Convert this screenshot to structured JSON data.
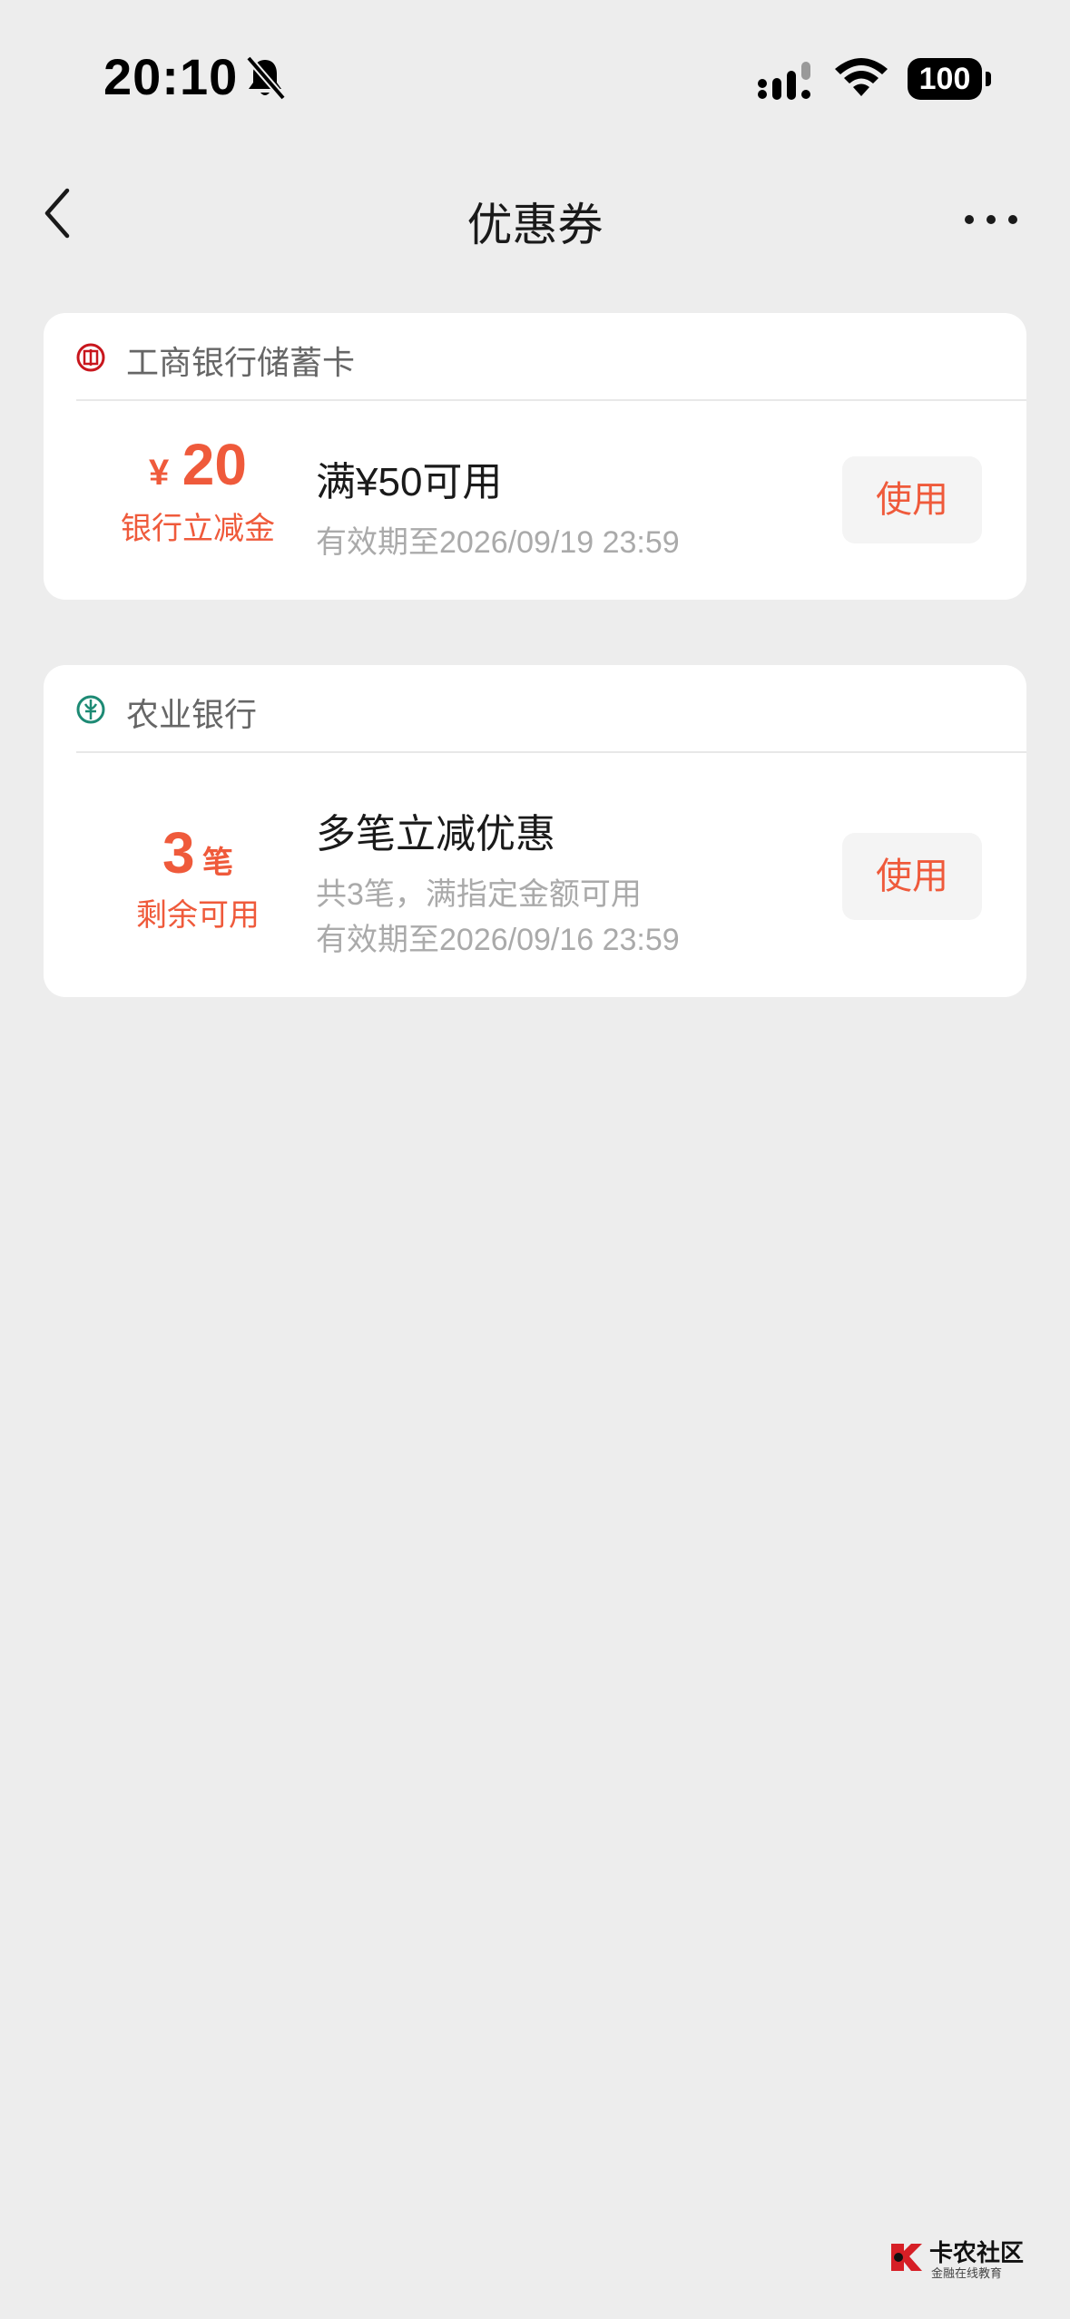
{
  "status_bar": {
    "time": "20:10",
    "battery": "100"
  },
  "nav": {
    "title": "优惠券"
  },
  "coupons": [
    {
      "bank": "工商银行储蓄卡",
      "amount_prefix": "¥",
      "amount": "20",
      "amount_label": "银行立减金",
      "title": "满¥50可用",
      "validity": "有效期至2026/09/19 23:59",
      "button": "使用",
      "logo_color": "#c8161d"
    },
    {
      "bank": "农业银行",
      "count": "3",
      "count_unit": "笔",
      "count_label": "剩余可用",
      "title": "多笔立减优惠",
      "condition": "共3笔，满指定金额可用",
      "validity": "有效期至2026/09/16 23:59",
      "button": "使用",
      "logo_color": "#1d8a74"
    }
  ],
  "watermark": {
    "title": "卡农社区",
    "subtitle": "金融在线教育"
  },
  "colors": {
    "accent": "#ef5a3b",
    "background": "#ededed",
    "card": "#ffffff",
    "muted_text": "#aaaaaa"
  }
}
